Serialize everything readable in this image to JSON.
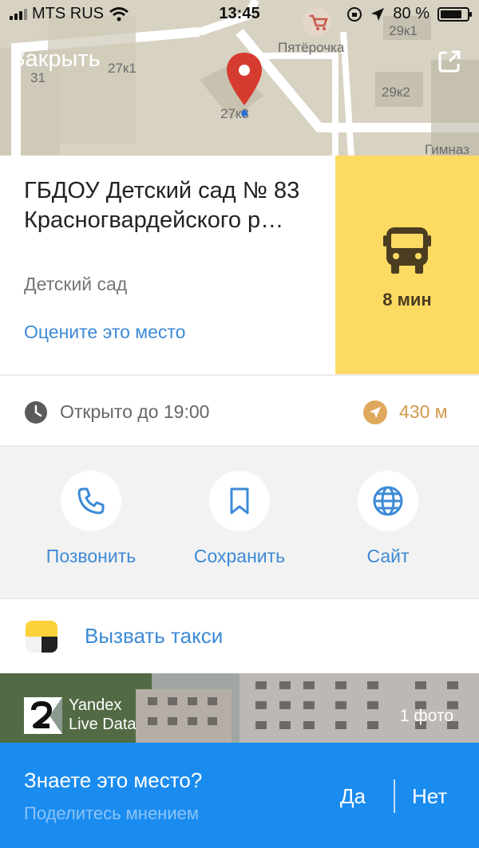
{
  "status_bar": {
    "carrier": "MTS RUS",
    "time": "13:45",
    "battery_percent": "80 %",
    "battery_level": 0.8
  },
  "map": {
    "labels": [
      "31",
      "27к1",
      "27к3",
      "Пятёрочка",
      "29к1",
      "29к2",
      "Гимназ"
    ],
    "close_label": "Закрыть",
    "pin_color": "#d63b2f"
  },
  "place": {
    "title": "ГБДОУ Детский сад № 83 Красногвардейского р…",
    "category": "Детский сад",
    "rate_link": "Оцените это место"
  },
  "route": {
    "eta": "8 мин",
    "icon": "bus-icon",
    "bg_color": "#fddb63"
  },
  "info": {
    "hours": "Открыто до 19:00",
    "distance": "430 м"
  },
  "actions": [
    {
      "label": "Позвонить",
      "icon": "phone-icon"
    },
    {
      "label": "Сохранить",
      "icon": "bookmark-icon"
    },
    {
      "label": "Сайт",
      "icon": "globe-icon"
    }
  ],
  "taxi": {
    "label": "Вызвать такси"
  },
  "photo": {
    "brand_line1": "Yandex",
    "brand_line2": "Live Data",
    "count": "1 фото"
  },
  "feedback": {
    "question": "Знаете это место?",
    "prompt": "Поделитесь мнением",
    "yes": "Да",
    "no": "Нет"
  },
  "colors": {
    "link": "#3d8ad6",
    "bottom_bar": "#1a8cf0",
    "distance": "#d39a4c"
  }
}
